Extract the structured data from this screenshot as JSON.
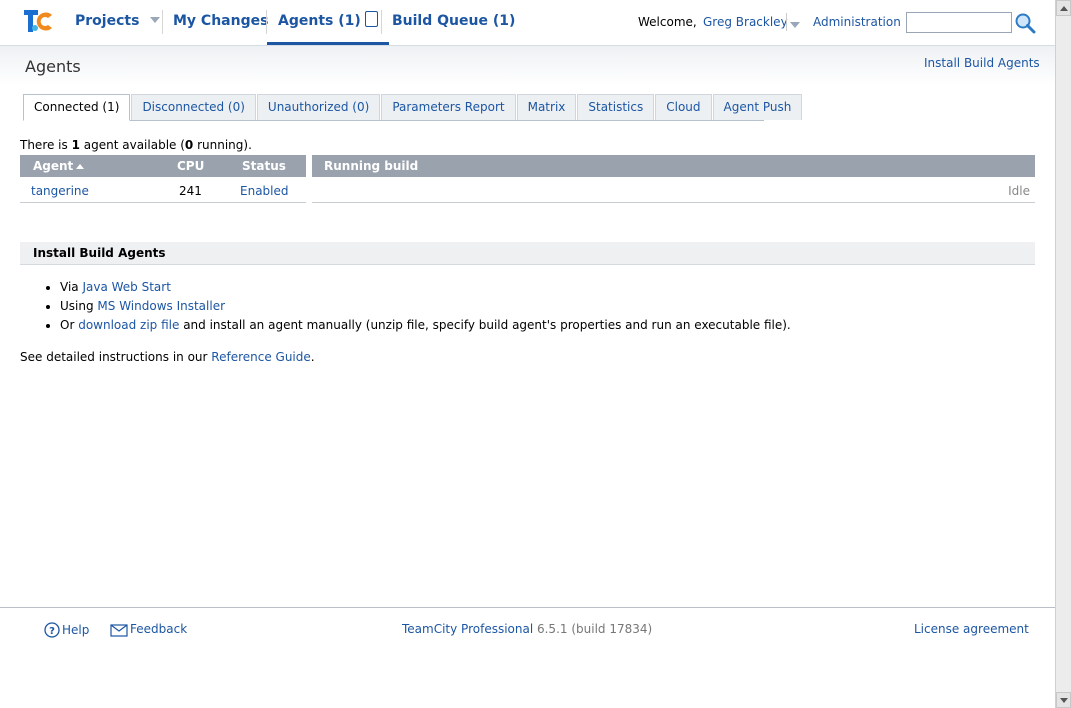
{
  "nav": {
    "projects": "Projects",
    "my_changes": "My Changes",
    "agents": "Agents (1)",
    "build_queue": "Build Queue (1)",
    "welcome": "Welcome,",
    "user": "Greg Brackley",
    "administration": "Administration",
    "search_value": ""
  },
  "page": {
    "title": "Agents",
    "install_link": "Install Build Agents"
  },
  "tabs": [
    {
      "label": "Connected (1)"
    },
    {
      "label": "Disconnected (0)"
    },
    {
      "label": "Unauthorized (0)"
    },
    {
      "label": "Parameters Report"
    },
    {
      "label": "Matrix"
    },
    {
      "label": "Statistics"
    },
    {
      "label": "Cloud"
    },
    {
      "label": "Agent Push"
    }
  ],
  "summary": {
    "prefix": "There is ",
    "count": "1",
    "mid": " agent available (",
    "running": "0",
    "suffix": " running)."
  },
  "table": {
    "headers": {
      "agent": "Agent",
      "cpu": "CPU",
      "status": "Status",
      "running": "Running build"
    },
    "rows": [
      {
        "agent": "tangerine",
        "cpu": "241",
        "status": "Enabled",
        "running": "Idle"
      }
    ]
  },
  "install": {
    "heading": "Install Build Agents",
    "items": [
      {
        "prefix": "Via ",
        "link": "Java Web Start",
        "suffix": ""
      },
      {
        "prefix": "Using ",
        "link": "MS Windows Installer",
        "suffix": ""
      },
      {
        "prefix": "Or ",
        "link": "download zip file",
        "suffix": " and install an agent manually (unzip file, specify build agent's properties and run an executable file)."
      }
    ],
    "ref_prefix": "See detailed instructions in our ",
    "ref_link": "Reference Guide",
    "ref_suffix": "."
  },
  "footer": {
    "help": "Help",
    "feedback": "Feedback",
    "product": "TeamCity Professional",
    "version": " 6.5.1 (build 17834)",
    "license": "License agreement"
  },
  "colors": {
    "link": "#1c56a3",
    "header_gray": "#9aa3ad",
    "accent": "#1c56a3"
  }
}
